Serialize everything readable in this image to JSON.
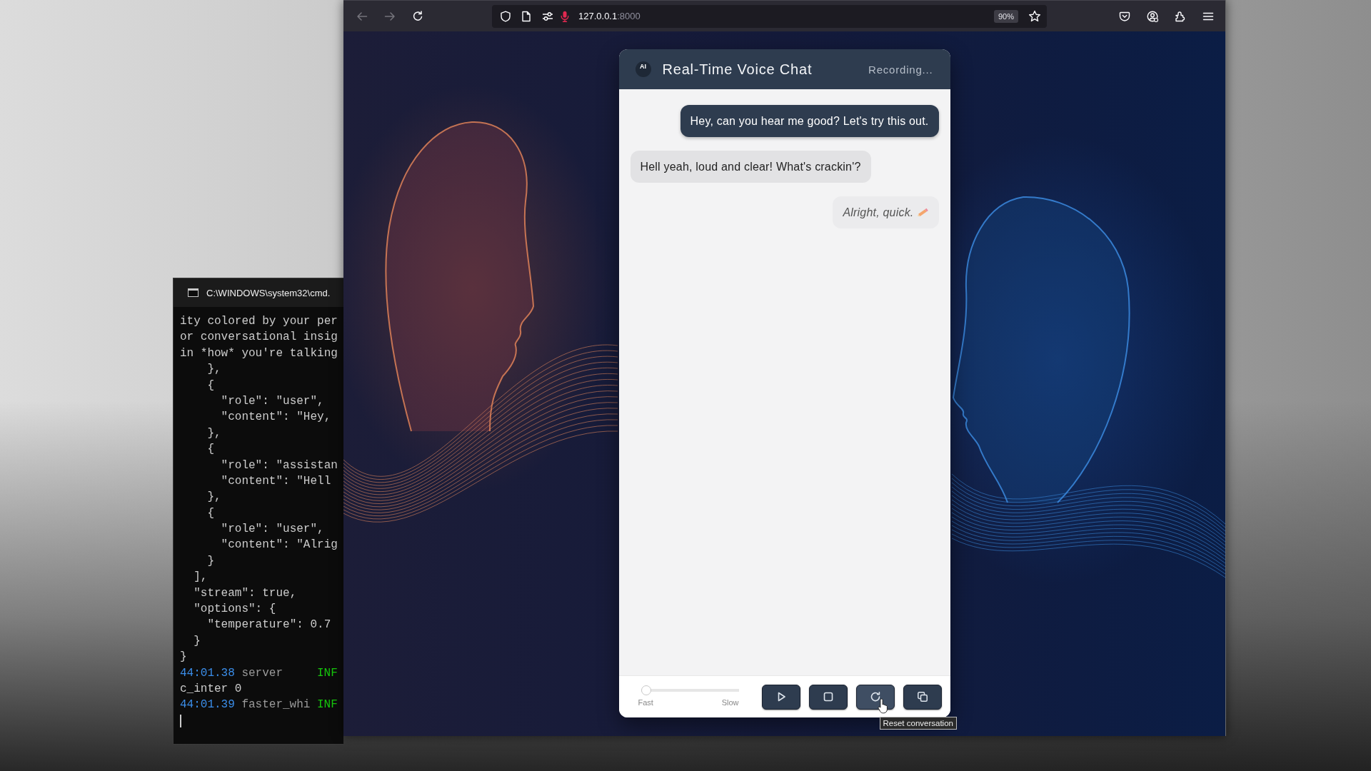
{
  "terminal": {
    "title": "C:\\WINDOWS\\system32\\cmd.",
    "lines": [
      {
        "kind": "text",
        "text": "ity colored by your per"
      },
      {
        "kind": "text",
        "text": "or conversational insig"
      },
      {
        "kind": "text",
        "text": "in *how* you're talking"
      },
      {
        "kind": "text",
        "text": "    },"
      },
      {
        "kind": "text",
        "text": "    {"
      },
      {
        "kind": "text",
        "text": "      \"role\": \"user\","
      },
      {
        "kind": "text",
        "text": "      \"content\": \"Hey,"
      },
      {
        "kind": "text",
        "text": "    },"
      },
      {
        "kind": "text",
        "text": "    {"
      },
      {
        "kind": "text",
        "text": "      \"role\": \"assistan"
      },
      {
        "kind": "text",
        "text": "      \"content\": \"Hell"
      },
      {
        "kind": "text",
        "text": "    },"
      },
      {
        "kind": "text",
        "text": "    {"
      },
      {
        "kind": "text",
        "text": "      \"role\": \"user\","
      },
      {
        "kind": "text",
        "text": "      \"content\": \"Alrig"
      },
      {
        "kind": "text",
        "text": "    }"
      },
      {
        "kind": "text",
        "text": "  ],"
      },
      {
        "kind": "text",
        "text": "  \"stream\": true,"
      },
      {
        "kind": "text",
        "text": "  \"options\": {"
      },
      {
        "kind": "text",
        "text": "    \"temperature\": 0.7"
      },
      {
        "kind": "text",
        "text": "  }"
      },
      {
        "kind": "text",
        "text": "}"
      },
      {
        "kind": "log",
        "time": "44:01.38",
        "source": "server",
        "severity": "INF"
      },
      {
        "kind": "text",
        "text": "c_inter 0"
      },
      {
        "kind": "log",
        "time": "44:01.39",
        "source": "faster_whi",
        "severity": "INF"
      }
    ]
  },
  "browser": {
    "back": {
      "disabled": true
    },
    "forward": {
      "disabled": true
    },
    "address": {
      "microphone_active": true,
      "host": "127.0.0.1",
      "port": ":8000"
    },
    "zoom": "90%"
  },
  "chat": {
    "avatar": "AI",
    "title": "Real-Time Voice Chat",
    "status": "Recording...",
    "messages": [
      {
        "kind": "sent",
        "typing": false,
        "text": "Hey, can you hear me good? Let's try this out."
      },
      {
        "kind": "received",
        "typing": false,
        "text": "Hell yeah, loud and clear! What's crackin'?"
      },
      {
        "kind": "sent",
        "typing": true,
        "text": "Alright, quick."
      }
    ],
    "speed": {
      "level": 0,
      "min_label": "Fast",
      "max_label": "Slow"
    },
    "buttons": [
      {
        "kind": "play",
        "hovered": false
      },
      {
        "kind": "stop",
        "hovered": false
      },
      {
        "kind": "reset",
        "hovered": true,
        "tooltip": "Reset conversation"
      },
      {
        "kind": "copy",
        "hovered": false
      }
    ]
  }
}
